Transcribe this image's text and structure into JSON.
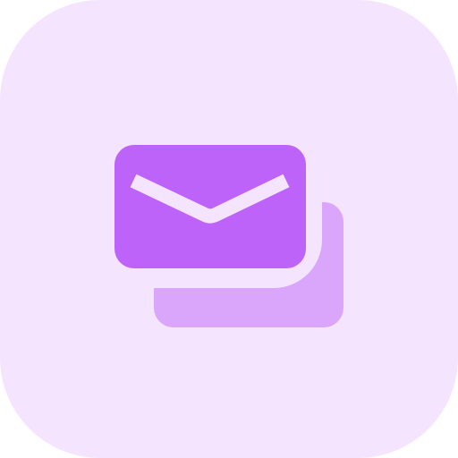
{
  "icon": {
    "name": "stacked-mail-icon",
    "colors": {
      "background": "#F5E4FD",
      "envelope_front": "#BE63F9",
      "envelope_back": "#DAA6FB",
      "flap": "#F5E4FD"
    }
  }
}
